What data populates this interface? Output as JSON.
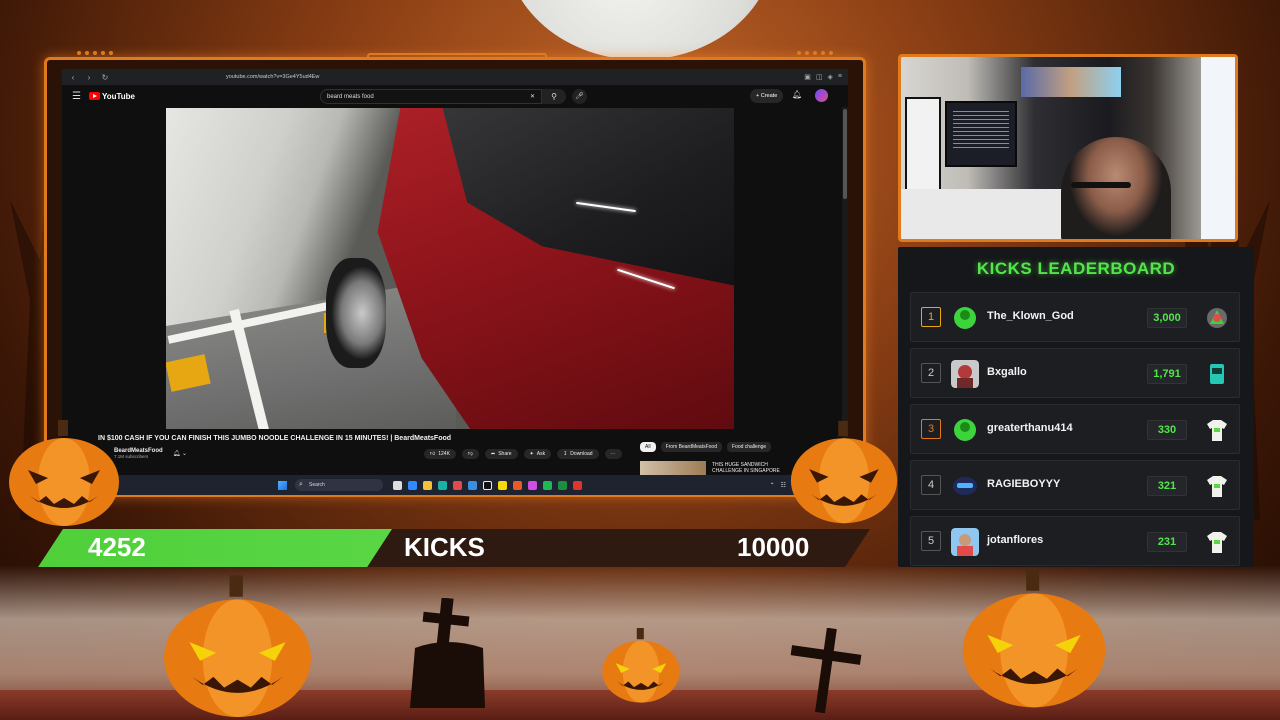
{
  "browser": {
    "url": "youtube.com/watch?v=3Ge4Y5ud4Ew"
  },
  "youtube": {
    "logo_text": "YouTube",
    "search_value": "beard meats food",
    "create_label": "+ Create",
    "video_title": "IN $100 CASH IF YOU CAN FINISH THIS JUMBO NOODLE CHALLENGE IN 15 MINUTES! | BeardMeatsFood",
    "channel_name": "BeardMeatsFood",
    "subscribers": "7.1M subscribers",
    "likes": "124K",
    "share_label": "Share",
    "ask_label": "Ask",
    "download_label": "Download",
    "chips": [
      "All",
      "From BeardMeatsFood",
      "Food challenge"
    ],
    "side_video_title": "THIS HUGE SANDWICH CHALLENGE IN SINGAPORE"
  },
  "taskbar": {
    "search_placeholder": "Search"
  },
  "leaderboard": {
    "title": "KICKS LEADERBOARD",
    "entries": [
      {
        "rank": "1",
        "name": "The_Klown_God",
        "score": "3,000"
      },
      {
        "rank": "2",
        "name": "Bxgallo",
        "score": "1,791"
      },
      {
        "rank": "3",
        "name": "greaterthanu414",
        "score": "330"
      },
      {
        "rank": "4",
        "name": "RAGIEBOYYY",
        "score": "321"
      },
      {
        "rank": "5",
        "name": "jotanflores",
        "score": "231"
      }
    ]
  },
  "kicks_goal": {
    "current": "4252",
    "label": "KICKS",
    "goal": "10000",
    "progress": 0.4252
  },
  "colors": {
    "accent_orange": "#e07a1f",
    "leader_green": "#53e64a"
  }
}
